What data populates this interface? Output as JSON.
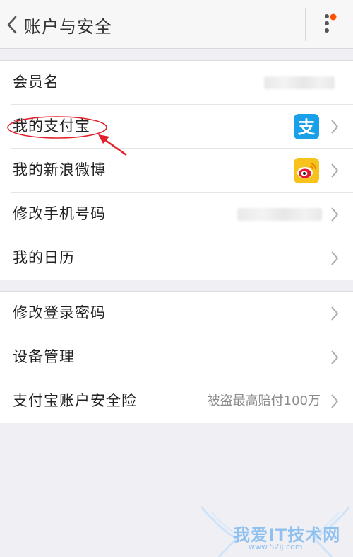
{
  "header": {
    "title": "账户与安全"
  },
  "groups": [
    {
      "rows": [
        {
          "label": "会员名",
          "value": ""
        },
        {
          "label": "我的支付宝",
          "icon": "alipay-icon"
        },
        {
          "label": "我的新浪微博",
          "icon": "weibo-icon"
        },
        {
          "label": "修改手机号码",
          "value": ""
        },
        {
          "label": "我的日历"
        }
      ]
    },
    {
      "rows": [
        {
          "label": "修改登录密码"
        },
        {
          "label": "设备管理"
        },
        {
          "label": "支付宝账户安全险",
          "value": "被盗最高赔付100万"
        }
      ]
    }
  ],
  "icons": {
    "alipay_glyph": "支"
  },
  "watermark": {
    "text": "我爱IT技术网",
    "url": "www.52ij.com"
  },
  "colors": {
    "accent_dot": "#ff5000",
    "alipay": "#1aa0e8",
    "weibo": "#f7c21b",
    "annotation": "#e0212b"
  }
}
